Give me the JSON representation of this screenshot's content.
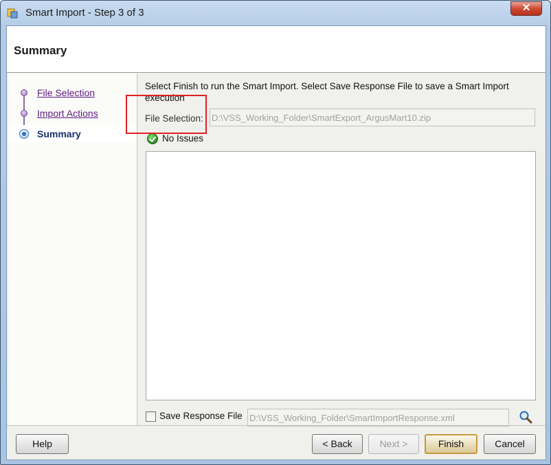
{
  "window": {
    "title": "Smart Import - Step 3 of 3",
    "close_label": "✕"
  },
  "header": {
    "title": "Summary"
  },
  "nav": {
    "items": [
      {
        "label": "File Selection",
        "state": "visited"
      },
      {
        "label": "Import Actions",
        "state": "visited"
      },
      {
        "label": "Summary",
        "state": "current"
      }
    ]
  },
  "main": {
    "instructions": "Select Finish to run the Smart Import. Select Save Response File to save a Smart Import execution",
    "file_selection_label": "File Selection:",
    "file_selection_value": "D:\\VSS_Working_Folder\\SmartExport_ArgusMart10.zip",
    "status_text": "No Issues",
    "save_response_label": "Save Response File",
    "save_response_checked": false,
    "response_file_value": "D:\\VSS_Working_Folder\\SmartImportResponse.xml"
  },
  "buttons": {
    "help": "Help",
    "back": "< Back",
    "next": "Next >",
    "finish": "Finish",
    "cancel": "Cancel"
  },
  "colors": {
    "highlight": "#e02020",
    "visited_link": "#5b1a82",
    "current_step": "#1a2e6b"
  }
}
